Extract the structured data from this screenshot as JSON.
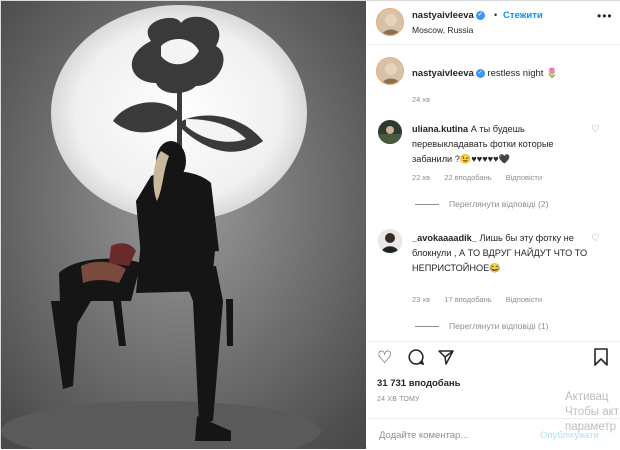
{
  "header": {
    "username": "nastyaivleeva",
    "separator": "•",
    "follow_label": "Стежити",
    "location": "Moscow, Russia",
    "more_icon": "more-dots-icon"
  },
  "caption": {
    "username": "nastyaivleeva",
    "text": "restless night 🌷",
    "time": "24 хв"
  },
  "comments": [
    {
      "username": "uliana.kutina",
      "text": "А ты будешь перевыкладавать фотки которые забанили ?😉♥♥♥♥♥🖤",
      "time": "22 хв",
      "likes": "22 вподобань",
      "reply": "Відповісти",
      "view_replies": "Переглянути відповіді (2)"
    },
    {
      "username": "_avokaaaadik_",
      "text": "Лишь бы эту фотку не блокнули , А ТО ВДРУГ НАЙДУТ ЧТО ТО НЕПРИСТОЙНОЕ😂",
      "time": "23 хв",
      "likes": "17 вподобань",
      "reply": "Відповісти",
      "view_replies": "Переглянути відповіді (1)"
    }
  ],
  "actions": {
    "likes_count": "31 731 вподобань",
    "post_time": "24 ХВ ТОМУ",
    "icons": [
      "heart-icon",
      "comment-icon",
      "share-icon",
      "bookmark-icon"
    ]
  },
  "add_comment": {
    "placeholder": "Додайте коментар...",
    "publish_label": "Опублікувати"
  },
  "watermark": {
    "line1": "Активац",
    "line2": "Чтобы акт",
    "line3": "параметр"
  },
  "colors": {
    "accent": "#0095f6",
    "verified": "#3897f0",
    "muted": "#8e8e8e"
  }
}
